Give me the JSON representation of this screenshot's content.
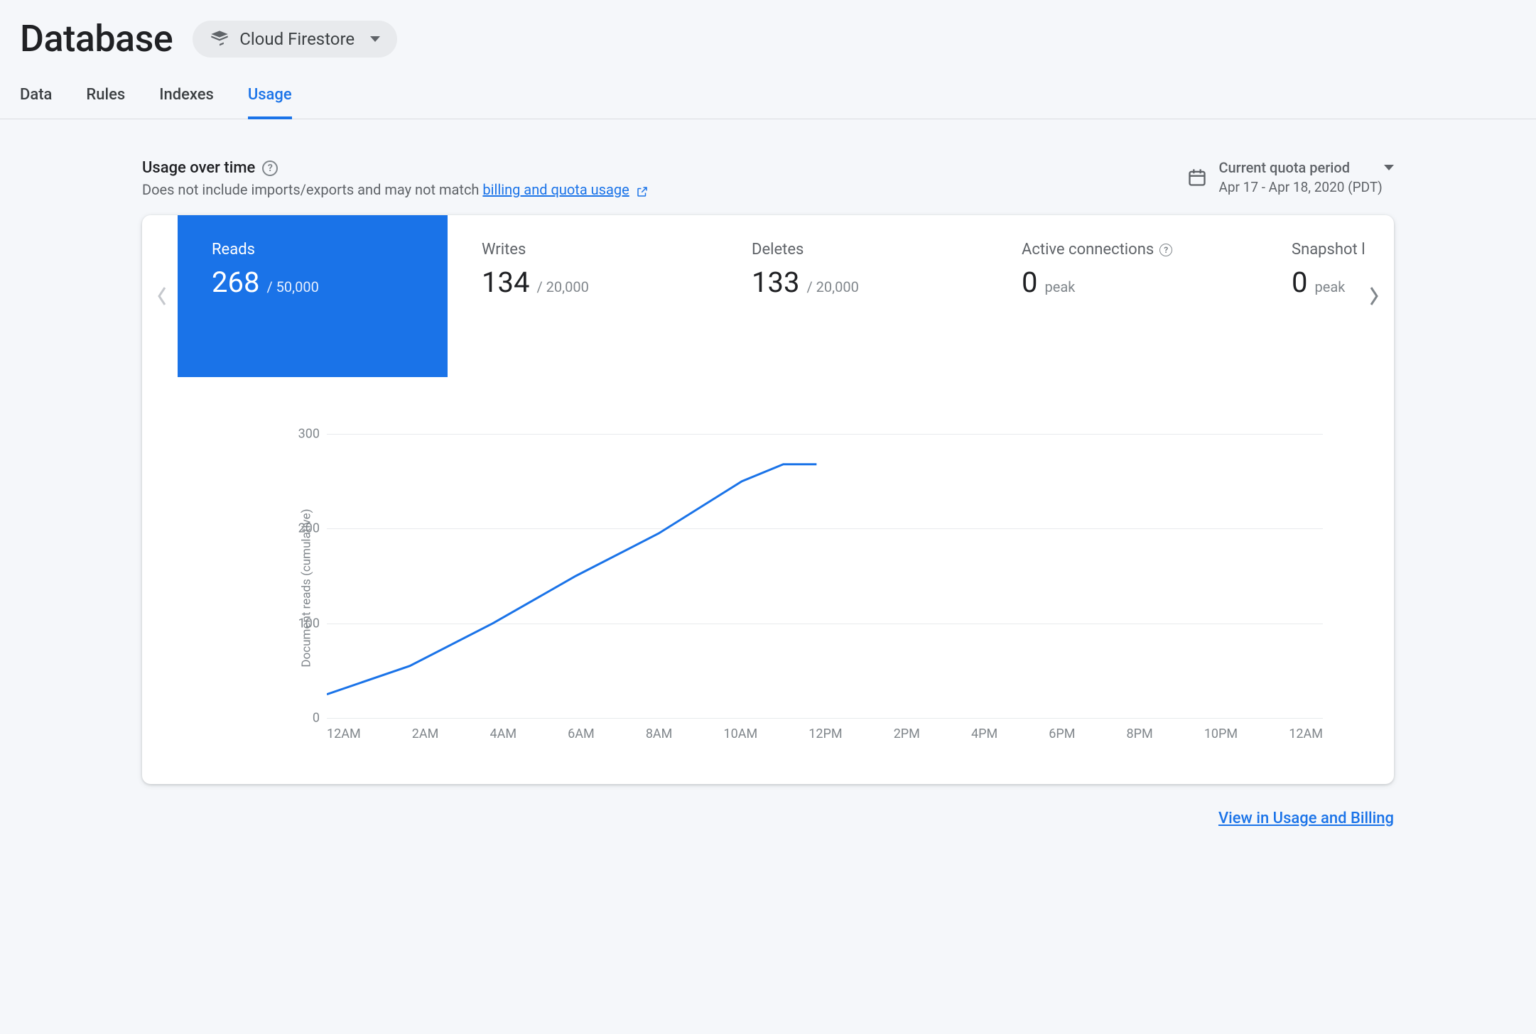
{
  "header": {
    "title": "Database",
    "selector_label": "Cloud Firestore"
  },
  "tabs": [
    {
      "label": "Data",
      "active": false
    },
    {
      "label": "Rules",
      "active": false
    },
    {
      "label": "Indexes",
      "active": false
    },
    {
      "label": "Usage",
      "active": true
    }
  ],
  "usage": {
    "title": "Usage over time",
    "subtitle_prefix": "Does not include imports/exports and may not match ",
    "subtitle_link": "billing and quota usage",
    "period_label": "Current quota period",
    "period_range": "Apr 17 - Apr 18, 2020 (PDT)"
  },
  "metrics": [
    {
      "label": "Reads",
      "value": "268",
      "limit": "/ 50,000",
      "active": true
    },
    {
      "label": "Writes",
      "value": "134",
      "limit": "/ 20,000",
      "active": false
    },
    {
      "label": "Deletes",
      "value": "133",
      "limit": "/ 20,000",
      "active": false
    },
    {
      "label": "Active connections",
      "value": "0",
      "limit": "peak",
      "active": false,
      "help": true
    },
    {
      "label": "Snapshot listeners",
      "value": "0",
      "limit": "peak",
      "active": false
    }
  ],
  "chart_data": {
    "type": "line",
    "ylabel": "Document reads (cumulative)",
    "ylim": [
      0,
      300
    ],
    "yticks": [
      0,
      100,
      200,
      300
    ],
    "x_categories": [
      "12AM",
      "2AM",
      "4AM",
      "6AM",
      "8AM",
      "10AM",
      "12PM",
      "2PM",
      "4PM",
      "6PM",
      "8PM",
      "10PM",
      "12AM"
    ],
    "series": [
      {
        "name": "Reads",
        "color": "#1a73e8",
        "points": [
          {
            "x": 0,
            "y": 25
          },
          {
            "x": 1,
            "y": 55
          },
          {
            "x": 2,
            "y": 100
          },
          {
            "x": 3,
            "y": 150
          },
          {
            "x": 4,
            "y": 195
          },
          {
            "x": 5,
            "y": 250
          },
          {
            "x": 5.5,
            "y": 268
          },
          {
            "x": 5.9,
            "y": 268
          }
        ]
      }
    ]
  },
  "footer": {
    "link_label": "View in Usage and Billing"
  }
}
